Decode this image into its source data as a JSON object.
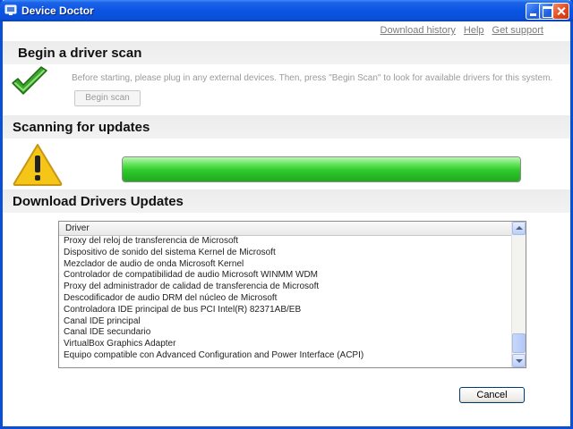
{
  "window": {
    "title": "Device Doctor"
  },
  "links": [
    "Download history",
    "Help",
    "Get support"
  ],
  "sections": {
    "scan": {
      "heading": "Begin a driver scan",
      "instructions": "Before starting, please plug in any external devices. Then, press \"Begin Scan\" to look for available drivers for this system.",
      "button": "Begin scan"
    },
    "scanning": {
      "heading": "Scanning for updates",
      "progress_percent": 100
    },
    "download": {
      "heading": "Download Drivers Updates",
      "column_header": "Driver",
      "drivers": [
        "Proxy del reloj de transferencia de Microsoft",
        "Dispositivo de sonido del sistema Kernel de Microsoft",
        "Mezclador de audio de onda Microsoft Kernel",
        "Controlador de compatibilidad de audio Microsoft WINMM WDM",
        "Proxy del administrador de calidad de transferencia de Microsoft",
        "Descodificador de audio DRM del núcleo de Microsoft",
        "Controladora IDE principal de bus PCI Intel(R) 82371AB/EB",
        "Canal IDE principal",
        "Canal IDE secundario",
        "VirtualBox Graphics Adapter",
        "Equipo compatible con Advanced Configuration and Power Interface (ACPI)"
      ]
    }
  },
  "footer": {
    "cancel": "Cancel"
  },
  "icons": {
    "app": "device-doctor-icon",
    "scan": "checkmark-icon",
    "scanning": "warning-icon"
  },
  "colors": {
    "titlebar": "#0a54e3",
    "progress": "#2ec92a",
    "warning": "#f5c518",
    "check": "#3aa62a"
  }
}
